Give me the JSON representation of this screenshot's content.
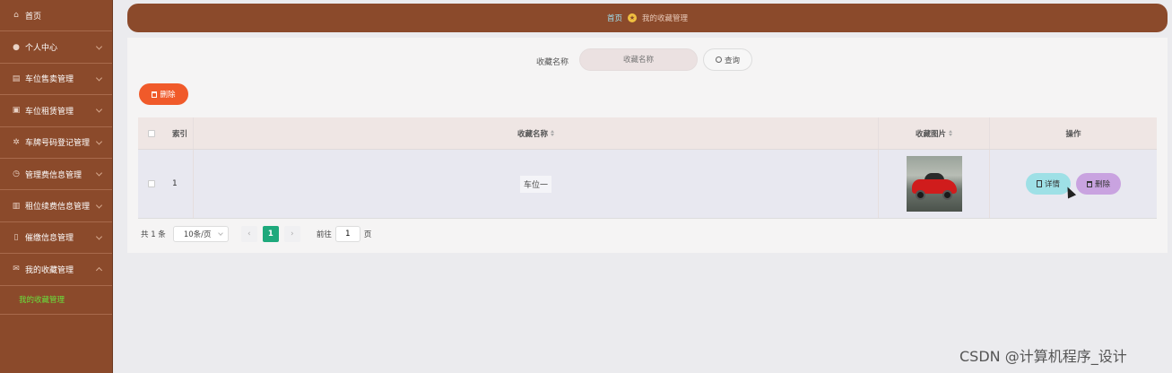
{
  "sidebar": {
    "items": [
      {
        "label": "首页",
        "icon": "home-icon",
        "glyph": "⌂",
        "has_chevron": false
      },
      {
        "label": "个人中心",
        "icon": "user-icon",
        "glyph": "●",
        "has_chevron": true
      },
      {
        "label": "车位售卖管理",
        "icon": "chat-icon",
        "glyph": "▤",
        "has_chevron": true
      },
      {
        "label": "车位租赁管理",
        "icon": "briefcase-icon",
        "glyph": "▣",
        "has_chevron": true
      },
      {
        "label": "车牌号码登记管理",
        "icon": "gear-icon",
        "glyph": "✲",
        "has_chevron": true
      },
      {
        "label": "管理费信息管理",
        "icon": "clock-icon",
        "glyph": "◷",
        "has_chevron": true
      },
      {
        "label": "租位续费信息管理",
        "icon": "bar-chart-icon",
        "glyph": "▥",
        "has_chevron": true
      },
      {
        "label": "催缴信息管理",
        "icon": "bookmark-icon",
        "glyph": "▯",
        "has_chevron": true
      },
      {
        "label": "我的收藏管理",
        "icon": "mail-icon",
        "glyph": "✉",
        "has_chevron": true
      }
    ],
    "sub_item": "我的收藏管理"
  },
  "breadcrumb": {
    "home": "首页",
    "current": "我的收藏管理",
    "separator_icon": "star-icon"
  },
  "search": {
    "label": "收藏名称",
    "placeholder": "收藏名称",
    "button": "查询"
  },
  "toolbar": {
    "delete_label": "删除"
  },
  "table": {
    "headers": [
      "索引",
      "收藏名称",
      "收藏图片",
      "操作"
    ],
    "rows": [
      {
        "index": "1",
        "name": "车位一",
        "image": "red-sports-car-photo",
        "detail_label": "详情",
        "delete_label": "删除"
      }
    ]
  },
  "pagination": {
    "total": "共 1 条",
    "page_size": "10条/页",
    "current_page": "1",
    "goto_prefix": "前往",
    "goto_value": "1",
    "goto_suffix": "页"
  },
  "watermark": "CSDN @计算机程序_设计",
  "colors": {
    "sidebar": "#8b4a2b",
    "accent_orange": "#f05a2a",
    "active_green": "#1ea97c",
    "submenu_text": "#68e13c"
  }
}
